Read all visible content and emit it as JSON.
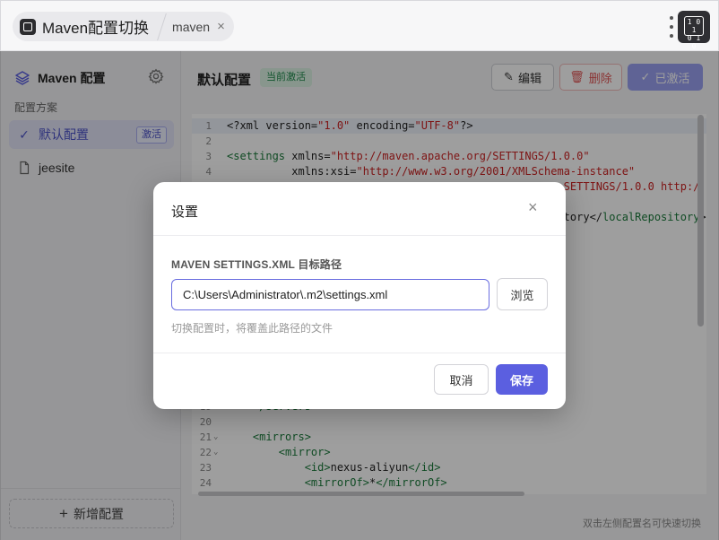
{
  "app": {
    "title": "Maven配置切换",
    "tab_label": "maven",
    "tab_close_icon": "×",
    "corner_icon_text": "101\n010"
  },
  "sidebar": {
    "title": "Maven 配置",
    "section_label": "配置方案",
    "items": [
      {
        "label": "默认配置",
        "badge": "激活",
        "icon": "✓",
        "active": true
      },
      {
        "label": "jeesite",
        "icon": "file-icon",
        "active": false
      }
    ],
    "add_button": "新增配置",
    "add_icon": "+"
  },
  "main": {
    "title": "默认配置",
    "status_tag": "当前激活",
    "edit_button": "编辑",
    "delete_button": "删除",
    "activated_button": "已激活",
    "hint": "双击左侧配置名可快速切换"
  },
  "editor": {
    "lines": [
      {
        "n": "1",
        "html": "<span class=\"at\">&lt;?xml version=</span><span class=\"sv\">\"1.0\"</span><span class=\"at\"> encoding=</span><span class=\"sv\">\"UTF-8\"</span><span class=\"at\">?&gt;</span>"
      },
      {
        "n": "2",
        "html": ""
      },
      {
        "n": "3",
        "html": "<span class=\"tg\">&lt;settings</span><span class=\"at\"> xmlns=</span><span class=\"sv\">\"http://maven.apache.org/SETTINGS/1.0.0\"</span>"
      },
      {
        "n": "4",
        "html": "<span class=\"at\">          xmlns:xsi=</span><span class=\"sv\">\"http://www.w3.org/2001/XMLSchema-instance\"</span>"
      },
      {
        "n": "5",
        "html": "<span class=\"sv\">                                                    SETTINGS/1.0.0 http:/</span>"
      },
      {
        "n": "6",
        "html": "<span class=\"at\">                                                    tory&lt;/</span><span class=\"tg\">localRepository</span><span class=\"at\">&gt;</span>"
      },
      {
        "n": "19",
        "html": "<span class=\"tg\">    &lt;/servers&gt;</span>"
      },
      {
        "n": "20",
        "html": ""
      },
      {
        "n": "21",
        "html": "<span class=\"tg\">    &lt;mirrors&gt;</span>"
      },
      {
        "n": "22",
        "html": "<span class=\"tg\">        &lt;mirror&gt;</span>"
      },
      {
        "n": "23",
        "html": "<span class=\"tg\">            &lt;id&gt;</span><span class=\"at\">nexus-aliyun</span><span class=\"tg\">&lt;/id&gt;</span>"
      },
      {
        "n": "24",
        "html": "<span class=\"tg\">            &lt;mirrorOf&gt;</span><span class=\"at\">*</span><span class=\"tg\">&lt;/mirrorOf&gt;</span>"
      }
    ]
  },
  "dialog": {
    "title": "设置",
    "close_icon": "×",
    "field_label": "MAVEN SETTINGS.XML 目标路径",
    "path_value": "C:\\Users\\Administrator\\.m2\\settings.xml",
    "browse_button": "浏览",
    "help_text": "切换配置时，将覆盖此路径的文件",
    "cancel_button": "取消",
    "save_button": "保存"
  },
  "colors": {
    "accent": "#5b5fe0",
    "active_bg": "#e3e4f7",
    "success_bg": "#dcf3e4",
    "success_text": "#1f8a4c",
    "danger": "#e05555",
    "overlay": "rgba(0,0,0,0.38)"
  }
}
